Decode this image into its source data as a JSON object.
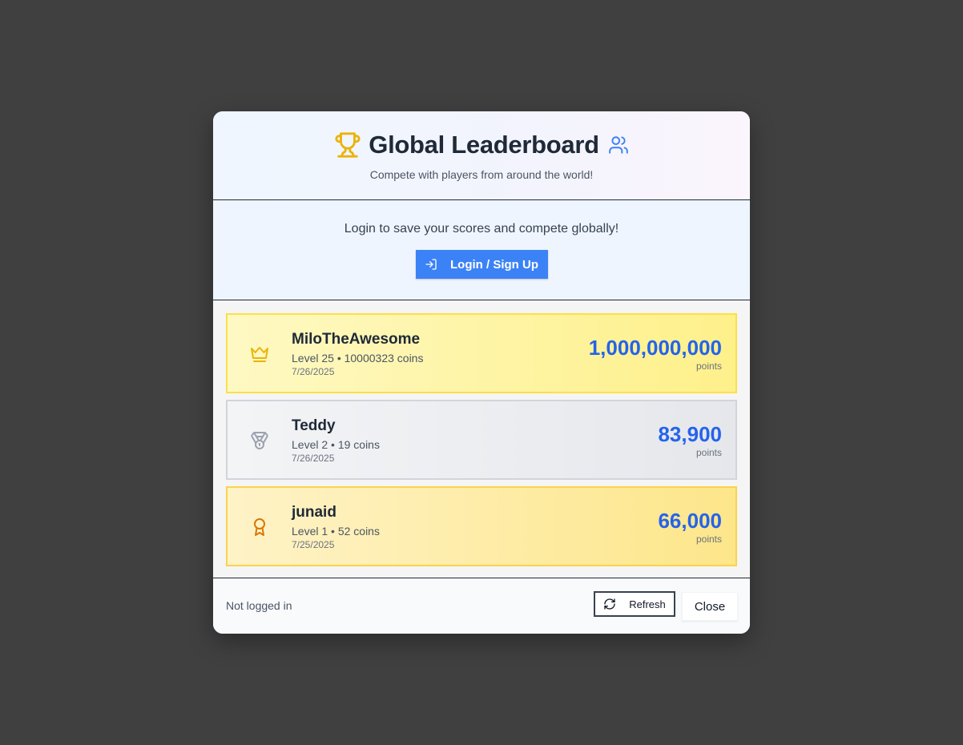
{
  "header": {
    "title": "Global Leaderboard",
    "subtitle": "Compete with players from around the world!",
    "title_icon": "trophy-icon",
    "users_icon": "users-icon"
  },
  "login_panel": {
    "message": "Login to save your scores and compete globally!",
    "button_label": "Login / Sign Up",
    "button_icon": "login-icon"
  },
  "entries": [
    {
      "rank_icon": "crown-icon",
      "name": "MiloTheAwesome",
      "meta": "Level 25 • 10000323 coins",
      "date": "7/26/2025",
      "score": "1,000,000,000",
      "score_unit": "points"
    },
    {
      "rank_icon": "medal-icon",
      "name": "Teddy",
      "meta": "Level 2 • 19 coins",
      "date": "7/26/2025",
      "score": "83,900",
      "score_unit": "points"
    },
    {
      "rank_icon": "award-icon",
      "name": "junaid",
      "meta": "Level 1 • 52 coins",
      "date": "7/25/2025",
      "score": "66,000",
      "score_unit": "points"
    }
  ],
  "footer": {
    "status": "Not logged in",
    "refresh_label": "Refresh",
    "refresh_icon": "refresh-icon",
    "close_label": "Close"
  },
  "colors": {
    "accent": "#3b82f6",
    "score": "#2563eb",
    "trophy": "#eab308",
    "backdrop": "#404040"
  }
}
